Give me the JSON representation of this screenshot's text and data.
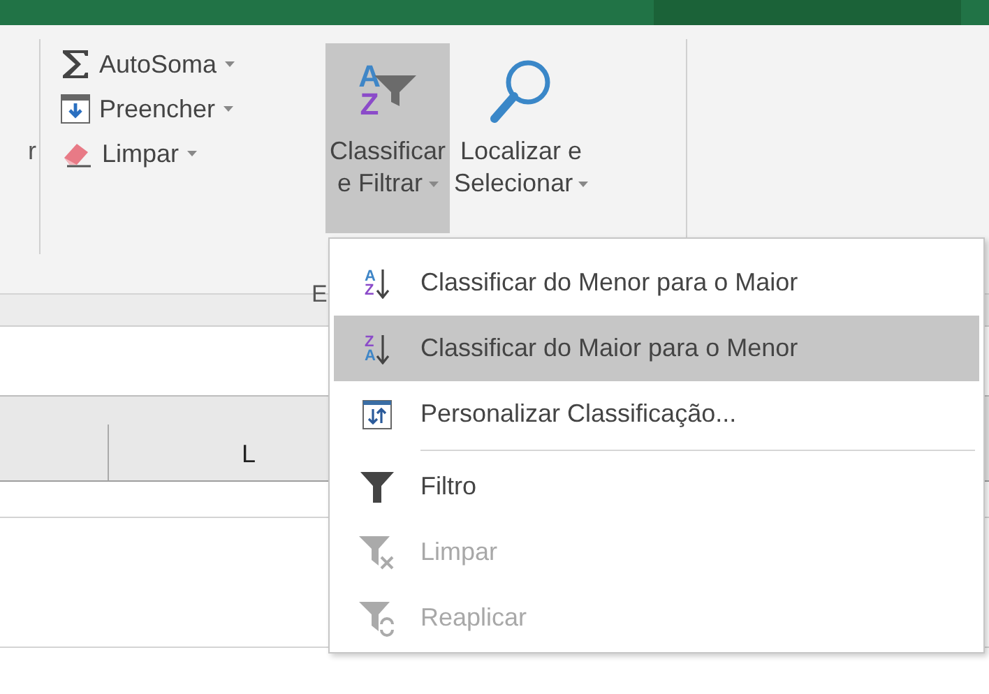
{
  "ribbon": {
    "cut_label": "r",
    "small_buttons": [
      {
        "kind": "sum",
        "label": "AutoSoma"
      },
      {
        "kind": "fill",
        "label": "Preencher"
      },
      {
        "kind": "clear",
        "label": "Limpar"
      }
    ],
    "large_buttons": [
      {
        "kind": "sort",
        "glyphs": [
          "A",
          "Z"
        ],
        "lines": [
          "Classificar",
          "e Filtrar"
        ],
        "selected": true
      },
      {
        "kind": "find",
        "lines": [
          "Localizar e",
          "Selecionar"
        ],
        "selected": false
      }
    ],
    "group_label": "E"
  },
  "sheet": {
    "column_header": "L"
  },
  "menu": {
    "groups": [
      [
        {
          "kind": "asc",
          "glyphs": [
            "A",
            "Z"
          ],
          "label": "Classificar do Menor para o Maior",
          "selected": false,
          "disabled": false
        },
        {
          "kind": "desc",
          "glyphs": [
            "Z",
            "A"
          ],
          "label": "Classificar do Maior para o Menor",
          "selected": true,
          "disabled": false
        },
        {
          "kind": "custom",
          "label": "Personalizar Classificação...",
          "selected": false,
          "disabled": false
        }
      ],
      [
        {
          "kind": "filter",
          "label": "Filtro",
          "selected": false,
          "disabled": false
        },
        {
          "kind": "clearfilter",
          "label": "Limpar",
          "selected": false,
          "disabled": true
        },
        {
          "kind": "reapply",
          "label": "Reaplicar",
          "selected": false,
          "disabled": true
        }
      ]
    ]
  }
}
